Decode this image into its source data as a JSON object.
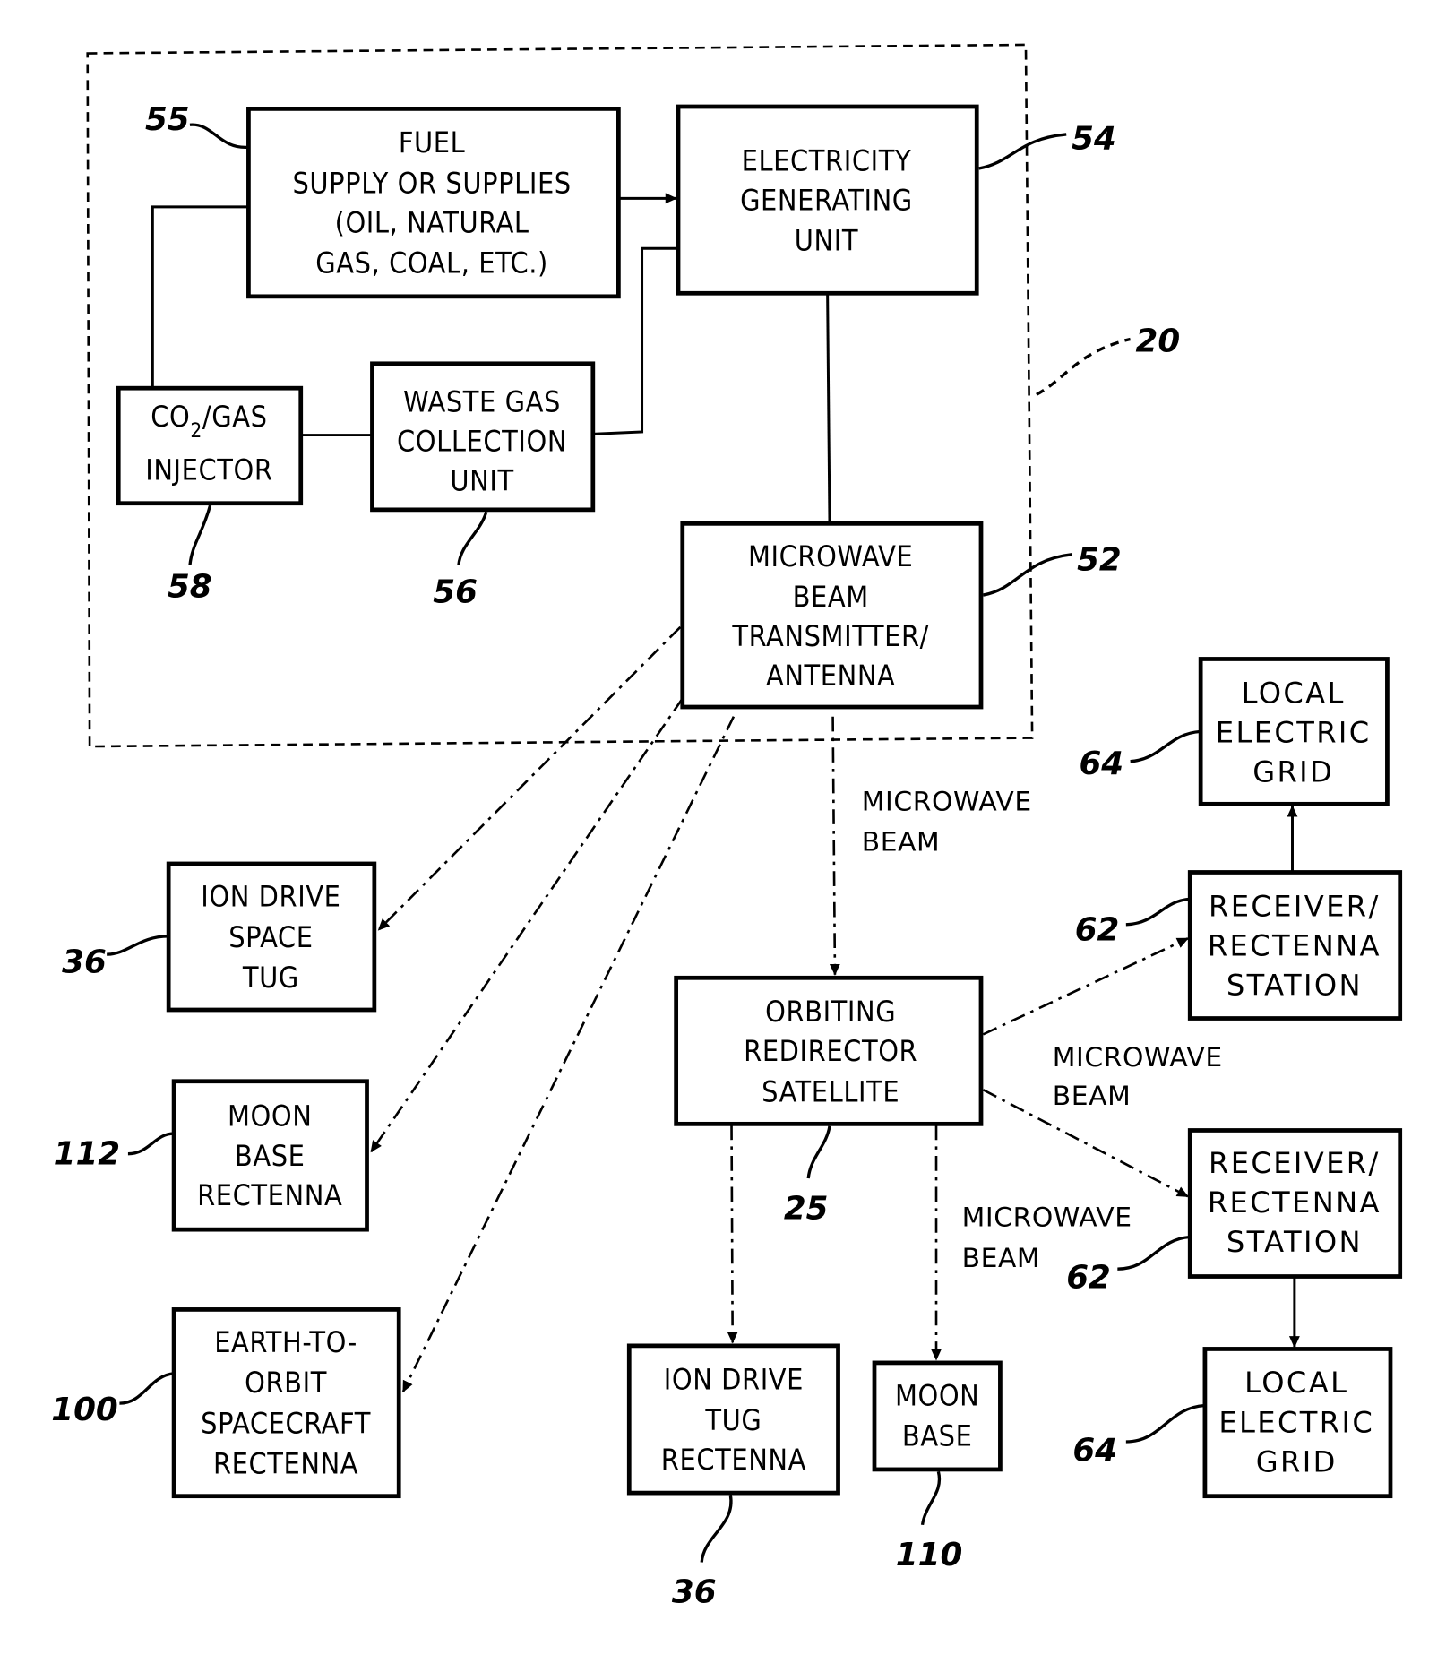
{
  "figure": {
    "system_reference": "20",
    "blocks": [
      {
        "id": "fuel-supply",
        "ref": "55",
        "lines": [
          "FUEL",
          "SUPPLY OR SUPPLIES",
          "(OIL, NATURAL",
          "GAS, COAL, ETC.)"
        ]
      },
      {
        "id": "electricity-generating-unit",
        "ref": "54",
        "lines": [
          "ELECTRICITY",
          "GENERATING",
          "UNIT"
        ]
      },
      {
        "id": "co2-gas-injector",
        "ref": "58",
        "lines": [
          "CO",
          "2",
          "/GAS",
          "INJECTOR"
        ]
      },
      {
        "id": "waste-gas-collection-unit",
        "ref": "56",
        "lines": [
          "WASTE GAS",
          "COLLECTION",
          "UNIT"
        ]
      },
      {
        "id": "microwave-beam-transmitter",
        "ref": "52",
        "lines": [
          "MICROWAVE",
          "BEAM",
          "TRANSMITTER/",
          "ANTENNA"
        ]
      },
      {
        "id": "ion-drive-space-tug",
        "ref": "36",
        "lines": [
          "ION DRIVE",
          "SPACE",
          "TUG"
        ]
      },
      {
        "id": "moon-base-rectenna",
        "ref": "112",
        "lines": [
          "MOON",
          "BASE",
          "RECTENNA"
        ]
      },
      {
        "id": "earth-to-orbit-spacecraft-rectenna",
        "ref": "100",
        "lines": [
          "EARTH-TO-",
          "ORBIT",
          "SPACECRAFT",
          "RECTENNA"
        ]
      },
      {
        "id": "orbiting-redirector-satellite",
        "ref": "25",
        "lines": [
          "ORBITING",
          "REDIRECTOR",
          "SATELLITE"
        ]
      },
      {
        "id": "ion-drive-tug-rectenna",
        "ref": "36",
        "lines": [
          "ION DRIVE",
          "TUG",
          "RECTENNA"
        ]
      },
      {
        "id": "moon-base",
        "ref": "110",
        "lines": [
          "MOON",
          "BASE"
        ]
      },
      {
        "id": "local-electric-grid-top",
        "ref": "64",
        "lines": [
          "LOCAL",
          "ELECTRIC",
          "GRID"
        ]
      },
      {
        "id": "receiver-rectenna-station-top",
        "ref": "62",
        "lines": [
          "RECEIVER/",
          "RECTENNA",
          "STATION"
        ]
      },
      {
        "id": "receiver-rectenna-station-bottom",
        "ref": "62",
        "lines": [
          "RECEIVER/",
          "RECTENNA",
          "STATION"
        ]
      },
      {
        "id": "local-electric-grid-bottom",
        "ref": "64",
        "lines": [
          "LOCAL",
          "ELECTRIC",
          "GRID"
        ]
      }
    ],
    "annotations": {
      "beam_to_satellite": [
        "MICROWAVE",
        "BEAM"
      ],
      "beam_to_stations": [
        "MICROWAVE",
        "BEAM"
      ],
      "beam_to_moon_base": [
        "MICROWAVE",
        "BEAM"
      ]
    }
  }
}
